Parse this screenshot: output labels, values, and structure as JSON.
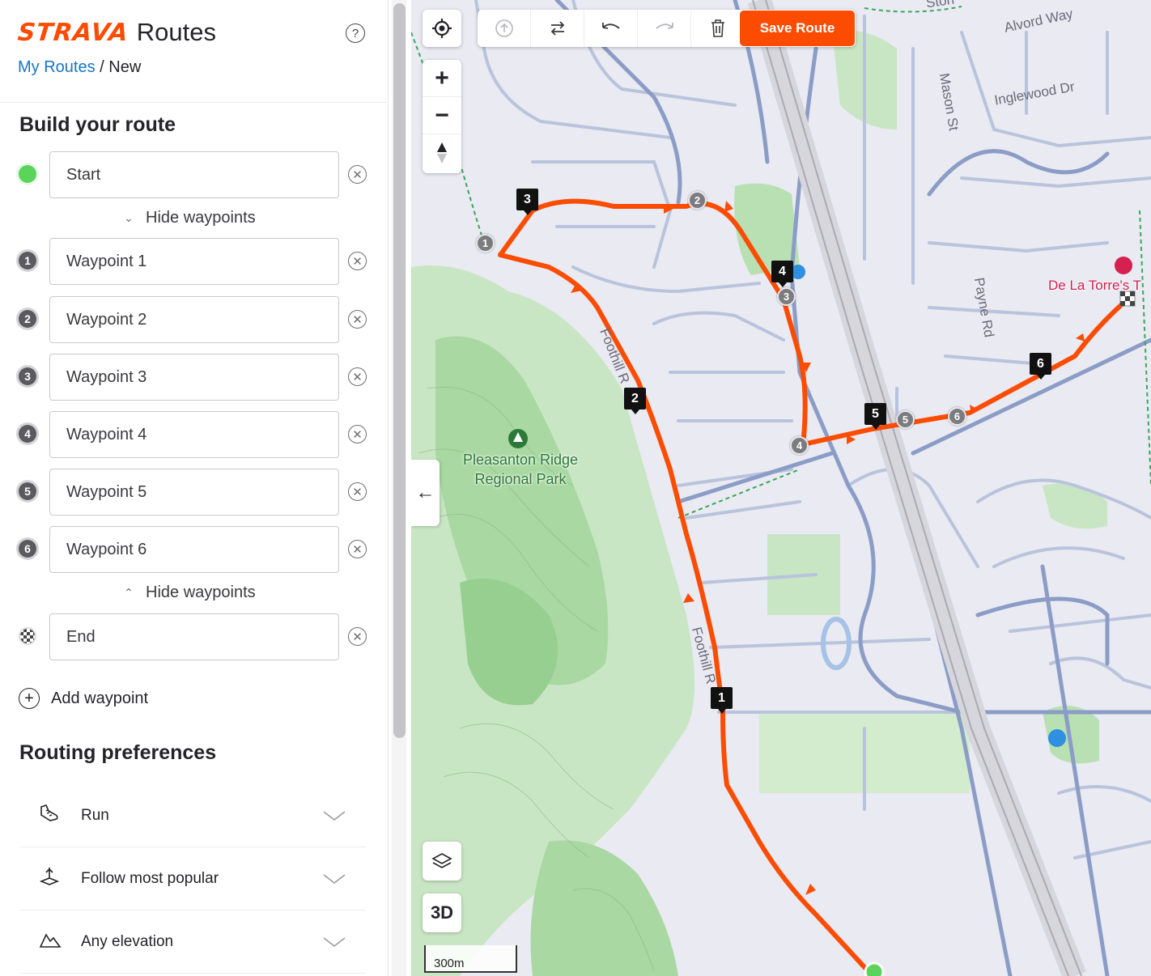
{
  "header": {
    "brand": "STRAVA",
    "product": "Routes",
    "help_icon": "question-circle-icon",
    "breadcrumb": {
      "link": "My Routes",
      "separator": "/",
      "current": "New"
    }
  },
  "builder": {
    "title": "Build your route",
    "start": {
      "value": "Start"
    },
    "hide_waypoints_top": "Hide waypoints",
    "waypoints": [
      {
        "number": "1",
        "value": "Waypoint 1"
      },
      {
        "number": "2",
        "value": "Waypoint 2"
      },
      {
        "number": "3",
        "value": "Waypoint 3"
      },
      {
        "number": "4",
        "value": "Waypoint 4"
      },
      {
        "number": "5",
        "value": "Waypoint 5"
      },
      {
        "number": "6",
        "value": "Waypoint 6"
      }
    ],
    "hide_waypoints_bottom": "Hide waypoints",
    "end": {
      "value": "End"
    },
    "add_waypoint": "Add waypoint"
  },
  "preferences": {
    "title": "Routing preferences",
    "items": [
      {
        "label": "Run",
        "icon": "shoe-icon"
      },
      {
        "label": "Follow most popular",
        "icon": "heatmap-pin-icon"
      },
      {
        "label": "Any elevation",
        "icon": "mountain-icon"
      }
    ]
  },
  "toolbar": {
    "save_label": "Save Route",
    "zoom_in": "+",
    "zoom_out": "−",
    "view_3d": "3D"
  },
  "map": {
    "park_name_1": "Pleasanton Ridge",
    "park_name_2": "Regional Park",
    "streets": {
      "alvord": "Alvord Way",
      "inglewood": "Inglewood Dr",
      "mason": "Mason St",
      "payne": "Payne Rd",
      "foothill_1": "Foothill R",
      "foothill_2": "Foothill R",
      "stone": "Ston"
    },
    "poi": "De La Torre's T",
    "scale": "300m",
    "flags": [
      "1",
      "2",
      "3",
      "4",
      "5",
      "6"
    ],
    "pins": [
      "1",
      "2",
      "3",
      "4",
      "5",
      "6"
    ]
  },
  "colors": {
    "accent": "#fc4c02",
    "route": "#fc4c02",
    "start": "#5ad45a",
    "link": "#1a73c8"
  }
}
